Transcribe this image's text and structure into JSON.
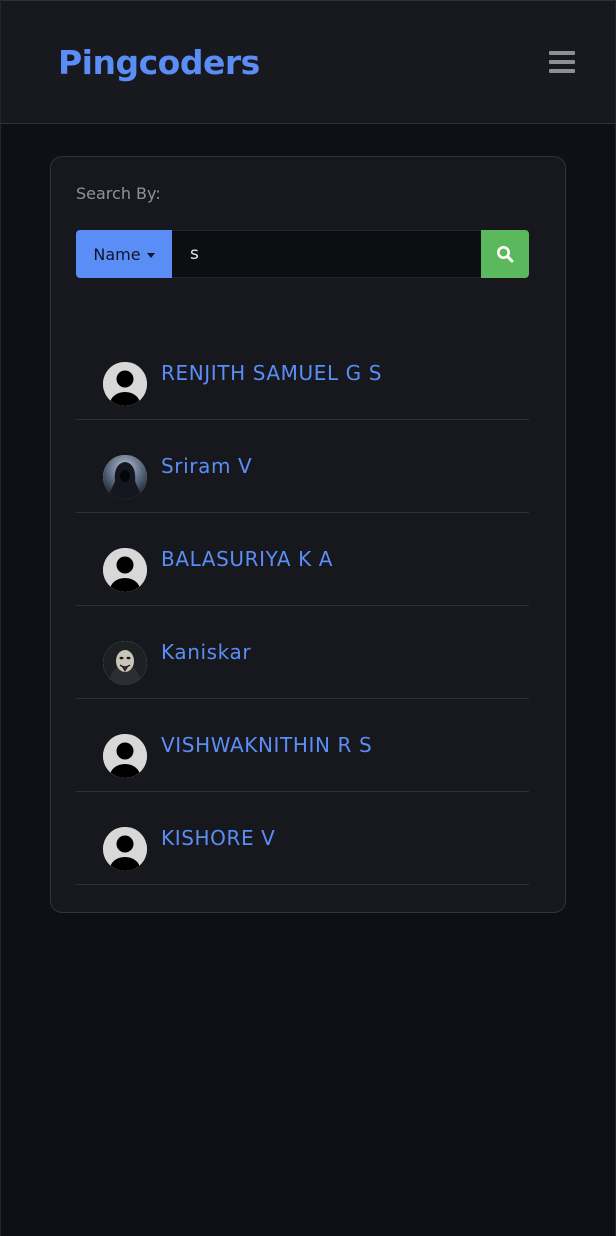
{
  "header": {
    "brand": "Pingcoders",
    "menu_icon": "hamburger-menu-icon"
  },
  "search": {
    "label": "Search By:",
    "filter_label": "Name",
    "query": "s",
    "button_icon": "search-icon"
  },
  "colors": {
    "accent": "#5b8df6",
    "search_button": "#5cb85c",
    "background": "#0e1015",
    "card": "#16181d"
  },
  "results": [
    {
      "name": "RENJITH SAMUEL G S",
      "avatar": "default-user-icon"
    },
    {
      "name": "Sriram V",
      "avatar": "hooded-figure-photo"
    },
    {
      "name": "BALASURIYA K A",
      "avatar": "default-user-icon"
    },
    {
      "name": "Kaniskar",
      "avatar": "masked-face-photo"
    },
    {
      "name": "VISHWAKNITHIN R S",
      "avatar": "default-user-icon"
    },
    {
      "name": "KISHORE V",
      "avatar": "default-user-icon"
    }
  ]
}
